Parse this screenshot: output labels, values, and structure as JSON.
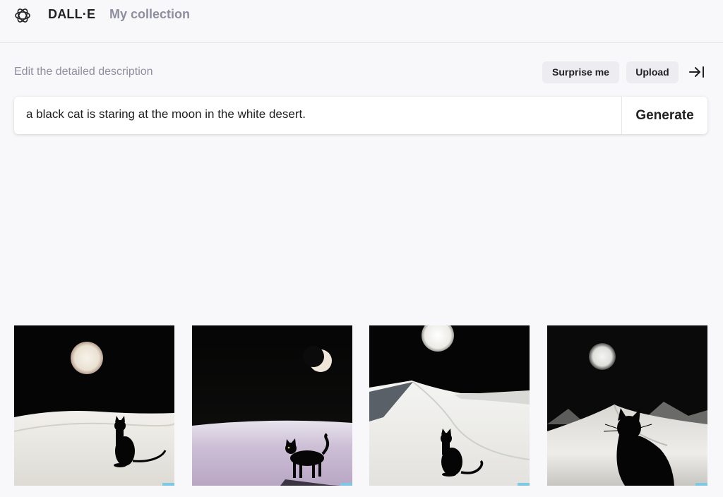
{
  "header": {
    "brand": "DALL·E",
    "nav_collection": "My collection",
    "logo_icon": "openai-logo-icon"
  },
  "editor": {
    "label": "Edit the detailed description",
    "surprise_label": "Surprise me",
    "upload_label": "Upload",
    "collapse_icon": "collapse-right-icon",
    "prompt_value": "a black cat is staring at the moon in the white desert.",
    "generate_label": "Generate"
  },
  "results": {
    "images": [
      {
        "subject": "black cat in white desert under full moon"
      },
      {
        "subject": "black cat in white desert under crescent moon"
      },
      {
        "subject": "black cat on white dunes under full moon"
      },
      {
        "subject": "black cat silhouette facing moon over dunes"
      }
    ]
  },
  "colors": {
    "background": "#f8f8fa",
    "button_bg": "#ececf1",
    "muted_text": "#8e8ea0",
    "text": "#202123"
  }
}
